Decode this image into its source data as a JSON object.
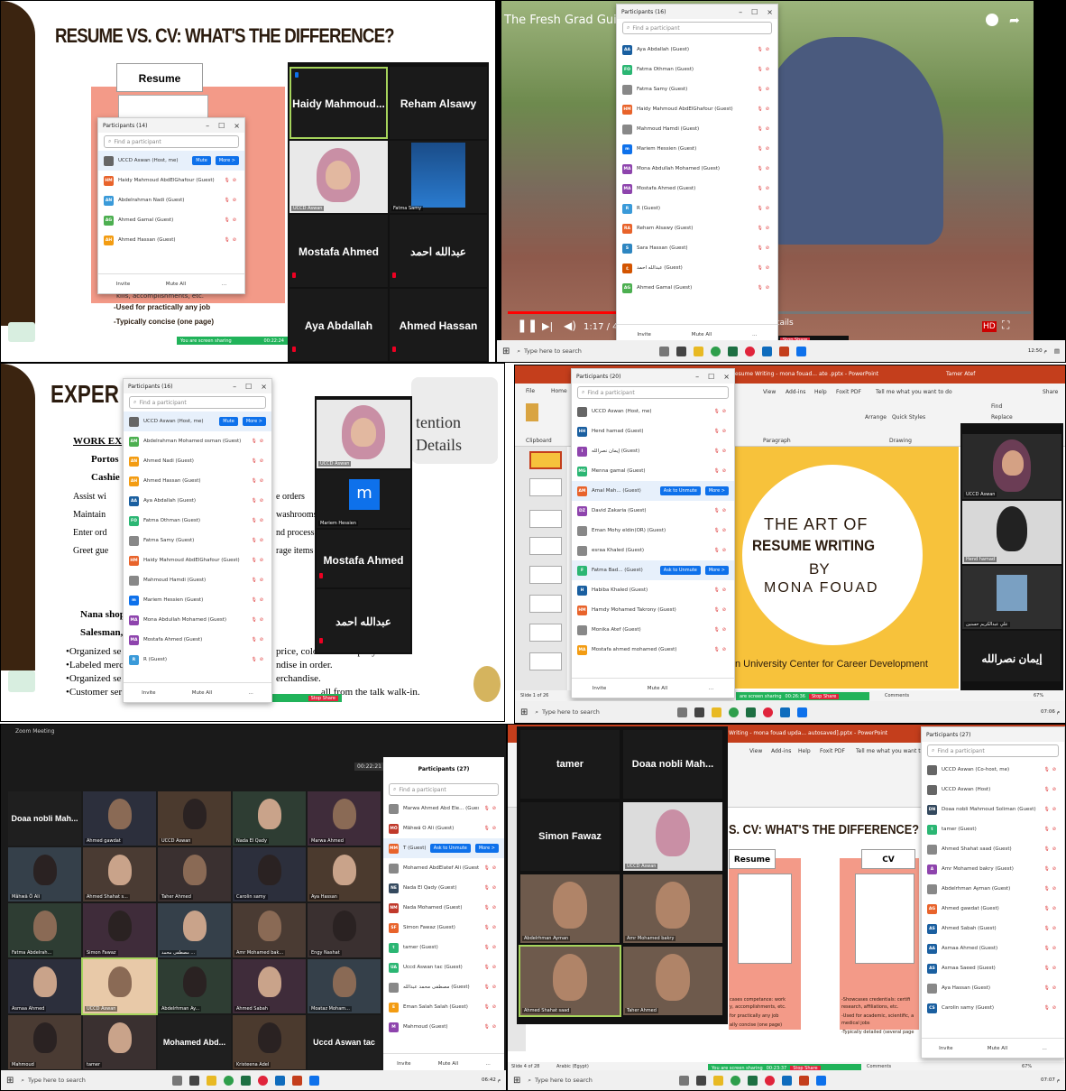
{
  "window_title": "Zoom Meeting",
  "p1": {
    "slide_title": "RESUME VS. CV:  WHAT'S THE DIFFERENCE?",
    "resume_label": "Resume",
    "bullet1": "-Used for practically any job",
    "bullet2": "-Typically concise (one page)",
    "partial": "kills, accomplishments, etc.",
    "share_text": "You are screen sharing",
    "timer": "00:22:24",
    "panel": {
      "title": "Participants (14)",
      "search": "Find a participant",
      "rows": [
        {
          "i": "",
          "n": "UCCD Aswan (Host, me)",
          "c": "#666",
          "b1": "Mute",
          "b2": "More >"
        },
        {
          "i": "HM",
          "n": "Haidy Mahmoud AbdElGhafour (Guest)",
          "c": "#e8632b"
        },
        {
          "i": "AN",
          "n": "Abdelrahman Nadi (Guest)",
          "c": "#3a9ad9"
        },
        {
          "i": "AG",
          "n": "Ahmed Gamal (Guest)",
          "c": "#4caf50"
        },
        {
          "i": "AH",
          "n": "Ahmed Hassan (Guest)",
          "c": "#f39c12"
        }
      ],
      "invite": "Invite",
      "muteall": "Mute All"
    },
    "tiles": [
      "Haidy  Mahmoud...",
      "Reham Alsawy",
      "Mostafa Ahmed",
      "عبدالله احمد",
      "Aya Abdallah",
      "Ahmed Hassan"
    ],
    "tile_labels": [
      "UCCD Aswan",
      "Fatma Samy"
    ]
  },
  "p2": {
    "video_title": "The Fresh Grad Guide",
    "time": "1:17 / 4:",
    "tails": "tails",
    "stop": "Stop Share",
    "panel": {
      "title": "Participants (16)",
      "search": "Find a participant",
      "rows": [
        {
          "i": "AA",
          "n": "Aya Abdallah (Guest)",
          "c": "#1a5fa0"
        },
        {
          "i": "FO",
          "n": "Fatma Othman (Guest)",
          "c": "#2bb673"
        },
        {
          "i": "",
          "n": "Fatma Samy (Guest)",
          "c": "#888"
        },
        {
          "i": "HM",
          "n": "Haidy Mahmoud AbdElGhafour (Guest)",
          "c": "#e8632b"
        },
        {
          "i": "",
          "n": "Mahmoud Hamdi (Guest)",
          "c": "#888"
        },
        {
          "i": "m",
          "n": "Mariem Hessien (Guest)",
          "c": "#0e71eb"
        },
        {
          "i": "MA",
          "n": "Mona Abdullah Mohamed (Guest)",
          "c": "#8e44ad"
        },
        {
          "i": "MA",
          "n": "Mostafa Ahmed (Guest)",
          "c": "#8e44ad"
        },
        {
          "i": "R",
          "n": "R (Guest)",
          "c": "#3a9ad9"
        },
        {
          "i": "RA",
          "n": "Reham Alsawy (Guest)",
          "c": "#e8632b"
        },
        {
          "i": "S",
          "n": "Sara Hassan (Guest)",
          "c": "#2e86c1"
        },
        {
          "i": "ع",
          "n": "عبدالله احمد (Guest)",
          "c": "#d35400"
        },
        {
          "i": "AG",
          "n": "Ahmed Gamal (Guest)",
          "c": "#4caf50"
        }
      ],
      "invite": "Invite",
      "muteall": "Mute All"
    },
    "taskbar_search": "Type here to search",
    "clock": "12:50 م"
  },
  "p3": {
    "title": "EXPER",
    "work": "WORK EX",
    "portos": "Portos",
    "cashier": "Cashie",
    "b1": "Assist wi",
    "b2": "Maintain",
    "b3": "Enter ord",
    "b4": "Greet gue",
    "r1": "e orders",
    "r2": "washrooms",
    "r3": "nd process",
    "r4": "rage items",
    "nana": "Nana shop",
    "sales": "Salesman,",
    "l1": "•Organized se",
    "l2": "•Labeled merc",
    "l3": "•Organized se",
    "l4": "•Customer ser",
    "m1": "price, color and company.",
    "m2": "ndise in order.",
    "m3": "erchandise.",
    "m4": "all from the talk walk-in.",
    "att1": "tention",
    "att2": "Details",
    "stop": "Stop Share",
    "panel": {
      "title": "Participants (16)",
      "search": "Find a participant",
      "rows": [
        {
          "i": "",
          "n": "UCCD Aswan (Host, me)",
          "c": "#666",
          "b1": "Mute",
          "b2": "More >"
        },
        {
          "i": "AM",
          "n": "Abdelrahman Mohamed osman (Guest)",
          "c": "#4caf50"
        },
        {
          "i": "AN",
          "n": "Ahmed Nadi (Guest)",
          "c": "#f39c12"
        },
        {
          "i": "AH",
          "n": "Ahmed Hassan (Guest)",
          "c": "#f39c12"
        },
        {
          "i": "AA",
          "n": "Aya Abdallah (Guest)",
          "c": "#1a5fa0"
        },
        {
          "i": "FO",
          "n": "Fatma Othman (Guest)",
          "c": "#2bb673"
        },
        {
          "i": "",
          "n": "Fatma Samy (Guest)",
          "c": "#888"
        },
        {
          "i": "HM",
          "n": "Haidy Mahmoud AbdElGhafour (Guest)",
          "c": "#e8632b"
        },
        {
          "i": "",
          "n": "Mahmoud Hamdi (Guest)",
          "c": "#888"
        },
        {
          "i": "m",
          "n": "Mariem Hessien (Guest)",
          "c": "#0e71eb"
        },
        {
          "i": "MA",
          "n": "Mona Abdullah Mohamed (Guest)",
          "c": "#8e44ad"
        },
        {
          "i": "MA",
          "n": "Mostafa Ahmed (Guest)",
          "c": "#8e44ad"
        },
        {
          "i": "R",
          "n": "R (Guest)",
          "c": "#3a9ad9"
        }
      ],
      "invite": "Invite",
      "muteall": "Mute All"
    },
    "tiles": [
      "UCCD Aswan",
      "Mariem Hessien",
      "Mostafa Ahmed",
      "عبدالله احمد"
    ]
  },
  "p4": {
    "ribbon_tabs": [
      "File",
      "Home"
    ],
    "ppt_title": "Resume Writing - mona fouad... ate .pptx - PowerPoint",
    "user": "Tamer Atef",
    "menu": [
      "view",
      "View",
      "Add-ins",
      "Help",
      "Foxit PDF",
      "Tell me what you want to do",
      "Share"
    ],
    "groups": [
      "Clipboard",
      "Paragraph",
      "Drawing",
      "Arrange",
      "Quick Styles"
    ],
    "find": "Find",
    "replace": "Replace",
    "t1": "THE ART OF",
    "t2": "RESUME WRITING",
    "t3": "BY",
    "t4": "MONA FOUAD",
    "footer": "n University Center for Career Development",
    "slide_info": "Slide 1 of 26",
    "share_text": "are screen sharing",
    "timer": "00:26:36",
    "stop": "Stop Share",
    "comments": "Comments",
    "zoom": "67%",
    "clock": "07:06 م",
    "panel": {
      "title": "Participants (20)",
      "search": "Find a participant",
      "rows": [
        {
          "i": "",
          "n": "UCCD Aswan (Host, me)",
          "c": "#666"
        },
        {
          "i": "HH",
          "n": "Hend hamad (Guest)",
          "c": "#1a5fa0"
        },
        {
          "i": "I",
          "n": "إيمان نصرالله (Guest)",
          "c": "#8e44ad"
        },
        {
          "i": "MG",
          "n": "Menna gamal (Guest)",
          "c": "#2bb673"
        },
        {
          "i": "AM",
          "n": "Amal Mah...  (Guest)",
          "c": "#e8632b",
          "b1": "Ask to Unmute",
          "b2": "More >"
        },
        {
          "i": "DZ",
          "n": "David Zakaria (Guest)",
          "c": "#8e44ad"
        },
        {
          "i": "",
          "n": "Eman Mohy eldin(OR) (Guest)",
          "c": "#888"
        },
        {
          "i": "",
          "n": "esraa Khaled (Guest)",
          "c": "#888"
        },
        {
          "i": "F",
          "n": "Fatma Bad...  (Guest)",
          "c": "#2bb673",
          "b1": "Ask to Unmute",
          "b2": "More >"
        },
        {
          "i": "H",
          "n": "Habiba Khaled (Guest)",
          "c": "#1a5fa0"
        },
        {
          "i": "HM",
          "n": "Hamdy Mohamed Takrony (Guest)",
          "c": "#e8632b"
        },
        {
          "i": "",
          "n": "Monika Atef (Guest)",
          "c": "#888"
        },
        {
          "i": "MA",
          "n": "Mostafa ahmed mohamed (Guest)",
          "c": "#f39c12"
        }
      ],
      "invite": "Invite",
      "muteall": "Mute All"
    },
    "tiles": [
      "UCCD Aswan",
      "Hend hamad",
      "علي عبدالكريم حسنين",
      "إيمان نصرالله"
    ],
    "taskbar_search": "Type here to search"
  },
  "p5": {
    "window": "Zoom Meeting",
    "timer": "00:22:21",
    "panel_title": "Participants (27)",
    "search": "Find a participant",
    "rows": [
      {
        "i": "",
        "n": "Marwa Ahmed Abd Ele...  (Guest)",
        "c": "#888"
      },
      {
        "i": "MÖ",
        "n": "Mâhwä Õ Ali (Guest)",
        "c": "#c0392b"
      },
      {
        "i": "MM",
        "n": "T (Guest)",
        "c": "#e8632b",
        "b1": "Ask to Unmute",
        "b2": "More >"
      },
      {
        "i": "",
        "n": "Mohamed AbdElatef Ali (Guest)",
        "c": "#888"
      },
      {
        "i": "NE",
        "n": "Nada El Qady (Guest)",
        "c": "#34495e"
      },
      {
        "i": "NM",
        "n": "Nada Mohamed (Guest)",
        "c": "#c0392b"
      },
      {
        "i": "SF",
        "n": "Simon Fawaz (Guest)",
        "c": "#e8632b"
      },
      {
        "i": "t",
        "n": "tamer (Guest)",
        "c": "#2bb673"
      },
      {
        "i": "UA",
        "n": "Uccd Aswan tac (Guest)",
        "c": "#2bb673"
      },
      {
        "i": "",
        "n": "مصطفى محمد عبدالله (Guest)",
        "c": "#888"
      },
      {
        "i": "E",
        "n": "Eman Salah Salah (Guest)",
        "c": "#f39c12"
      },
      {
        "i": "M",
        "n": "Mahmoud (Guest)",
        "c": "#8e44ad"
      }
    ],
    "invite": "Invite",
    "muteall": "Mute All",
    "tiles": [
      "Doaa nobli Mah...",
      "Ahmed gawdat",
      "UCCD Aswan",
      "Nada El Qady",
      "Marwa Ahmed",
      "Mâhwä Õ Ali",
      "Ahmed Shahat s...",
      "Taher Ahmed",
      "Carolin samy",
      "Aya Hassan",
      "Fatma Abdelrah...",
      "Simon Fawaz",
      "مصطفى محمد ...",
      "Amr Mohamed bak...",
      "Engy Nashat",
      "Asmaa Ahmed",
      "UCCD Aswan",
      "Abdelrhman Ay...",
      "Ahmed Sabah",
      "Moataz Moham...",
      "Mahmoud",
      "tamer",
      "Mohamed  Abd...",
      "Kristeena Adel",
      "Uccd Aswan tac"
    ],
    "taskbar_search": "Type here to search",
    "clock": "06:42 م"
  },
  "p6": {
    "ppt_title": "Writing - mona fouad upda... autosaved].pptx - PowerPoint",
    "menu": [
      "view",
      "View",
      "Add-ins",
      "Help",
      "Foxit PDF",
      "Tell me what you want to"
    ],
    "slide_title": "S. CV:  WHAT'S THE DIFFERENCE?",
    "resume": "Resume",
    "cv": "CV",
    "l1": "cases competance: work",
    "l2": "y, accomplishments, etc.",
    "l3": "for practically any job",
    "l4": "ally concise (one page)",
    "r1": "-Showcases credentials: certifi",
    "r2": "research, affiliations, etc.",
    "r3": "-Used for academic, scientific, a",
    "r4": "medical jobs",
    "r5": "-Typically detailed (several page",
    "slide_info": "Slide 4 of 28",
    "lang": "Arabic (Egypt)",
    "share_text": "You are screen sharing",
    "timer": "00:23:37",
    "stop": "Stop Share",
    "comments": "Comments",
    "zoom": "67%",
    "clock": "07:07 م",
    "tiles": [
      "tamer",
      "Doaa nobli Mah...",
      "Simon Fawaz",
      "UCCD Aswan",
      "Abdelrhman Ayman",
      "Amr Mohamed bakry",
      "Ahmed Shahat saad",
      "Taher Ahmed"
    ],
    "panel": {
      "title": "Participants (27)",
      "search": "Find a participant",
      "rows": [
        {
          "i": "",
          "n": "UCCD Aswan (Co-host, me)",
          "c": "#666"
        },
        {
          "i": "",
          "n": "UCCD Aswan (Host)",
          "c": "#666"
        },
        {
          "i": "DN",
          "n": "Doaa nobli Mahmoud Soliman (Guest)",
          "c": "#34495e"
        },
        {
          "i": "t",
          "n": "tamer (Guest)",
          "c": "#2bb673"
        },
        {
          "i": "",
          "n": "Ahmed Shahat saad (Guest)",
          "c": "#888"
        },
        {
          "i": "A",
          "n": "Amr Mohamed bakry (Guest)",
          "c": "#8e44ad"
        },
        {
          "i": "",
          "n": "Abdelrhman Ayman (Guest)",
          "c": "#888"
        },
        {
          "i": "AG",
          "n": "Ahmed gawdat (Guest)",
          "c": "#e8632b"
        },
        {
          "i": "AS",
          "n": "Ahmed Sabah (Guest)",
          "c": "#1a5fa0"
        },
        {
          "i": "AA",
          "n": "Asmaa Ahmed (Guest)",
          "c": "#1a5fa0"
        },
        {
          "i": "AS",
          "n": "Asmaa Saeed (Guest)",
          "c": "#1a5fa0"
        },
        {
          "i": "",
          "n": "Aya Hassan (Guest)",
          "c": "#888"
        },
        {
          "i": "CS",
          "n": "Carolin samy (Guest)",
          "c": "#1a5fa0"
        }
      ],
      "invite": "Invite",
      "muteall": "Mute All"
    },
    "taskbar_search": "Type here to search"
  }
}
